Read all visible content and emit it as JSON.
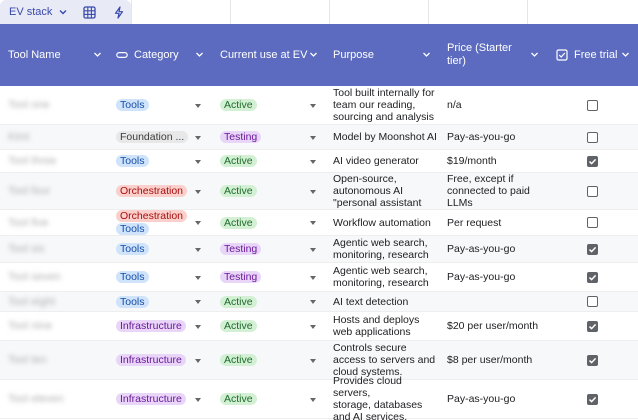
{
  "tab": {
    "name": "EV stack"
  },
  "header": {
    "tool_name": "Tool Name",
    "category": "Category",
    "current_use": "Current use at EV",
    "purpose": "Purpose",
    "price_line1": "Price (Starter",
    "price_line2": "tier)",
    "free_trial": "Free trial"
  },
  "rows": [
    {
      "name": "Tool one",
      "categories": [
        "Tools"
      ],
      "use": "Active",
      "purpose": [
        "Tool built internally for",
        "team our reading,",
        "sourcing and analysis"
      ],
      "price": [
        "n/a"
      ],
      "free_trial": false
    },
    {
      "name": "Kimi",
      "categories": [
        "Foundation ..."
      ],
      "use": "Testing",
      "purpose": [
        "Model by Moonshot AI"
      ],
      "price": [
        "Pay-as-you-go"
      ],
      "free_trial": false
    },
    {
      "name": "Tool three",
      "categories": [
        "Tools"
      ],
      "use": "Active",
      "purpose": [
        "AI video generator"
      ],
      "price": [
        "$19/month"
      ],
      "free_trial": true
    },
    {
      "name": "Tool four",
      "categories": [
        "Orchestration"
      ],
      "use": "Active",
      "purpose": [
        "Open-source,",
        "autonomous AI",
        "\"personal assistant"
      ],
      "price": [
        "Free, except if",
        "connected to paid",
        "LLMs"
      ],
      "free_trial": false
    },
    {
      "name": "Tool five",
      "categories": [
        "Orchestration",
        "Tools"
      ],
      "use": "Active",
      "purpose": [
        "Workflow automation"
      ],
      "price": [
        "Per request"
      ],
      "free_trial": false
    },
    {
      "name": "Tool six",
      "categories": [
        "Tools"
      ],
      "use": "Testing",
      "purpose": [
        "Agentic web search,",
        "monitoring, research"
      ],
      "price": [
        "Pay-as-you-go"
      ],
      "free_trial": true
    },
    {
      "name": "Tool seven",
      "categories": [
        "Tools"
      ],
      "use": "Testing",
      "purpose": [
        "Agentic web search,",
        "monitoring, research"
      ],
      "price": [
        "Pay-as-you-go"
      ],
      "free_trial": true
    },
    {
      "name": "Tool eight",
      "categories": [
        "Tools"
      ],
      "use": "Active",
      "purpose": [
        "AI text detection"
      ],
      "price": [
        ""
      ],
      "free_trial": false
    },
    {
      "name": "Tool nine",
      "categories": [
        "Infrastructure"
      ],
      "use": "Active",
      "purpose": [
        "Hosts and deploys",
        "web applications"
      ],
      "price": [
        "$20 per user/month"
      ],
      "free_trial": true
    },
    {
      "name": "Tool ten",
      "categories": [
        "Infrastructure"
      ],
      "use": "Active",
      "purpose": [
        "Controls secure",
        "access to servers and",
        "cloud systems."
      ],
      "price": [
        "$8 per user/month"
      ],
      "free_trial": true
    },
    {
      "name": "Tool eleven",
      "categories": [
        "Infrastructure"
      ],
      "use": "Active",
      "purpose": [
        "Provides cloud servers,",
        "storage, databases",
        "and AI services."
      ],
      "price": [
        "Pay-as-you-go"
      ],
      "free_trial": true
    }
  ]
}
